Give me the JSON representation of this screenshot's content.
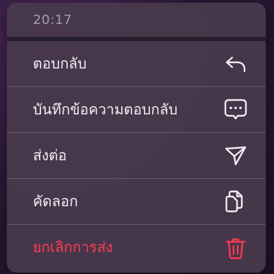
{
  "header": {
    "time": "20:17"
  },
  "menu": {
    "items": [
      {
        "label": "ตอบกลับ",
        "icon": "reply-icon"
      },
      {
        "label": "บันทึกข้อความตอบกลับ",
        "icon": "message-bubble-icon"
      },
      {
        "label": "ส่งต่อ",
        "icon": "send-icon"
      },
      {
        "label": "คัดลอก",
        "icon": "copy-icon"
      },
      {
        "label": "ยกเลิกการส่ง",
        "icon": "trash-icon"
      }
    ]
  },
  "colors": {
    "text": "#f3eef4",
    "destructive": "#ff3b4f",
    "menu_background": "#48384c",
    "timestamp": "#a79ca9"
  }
}
